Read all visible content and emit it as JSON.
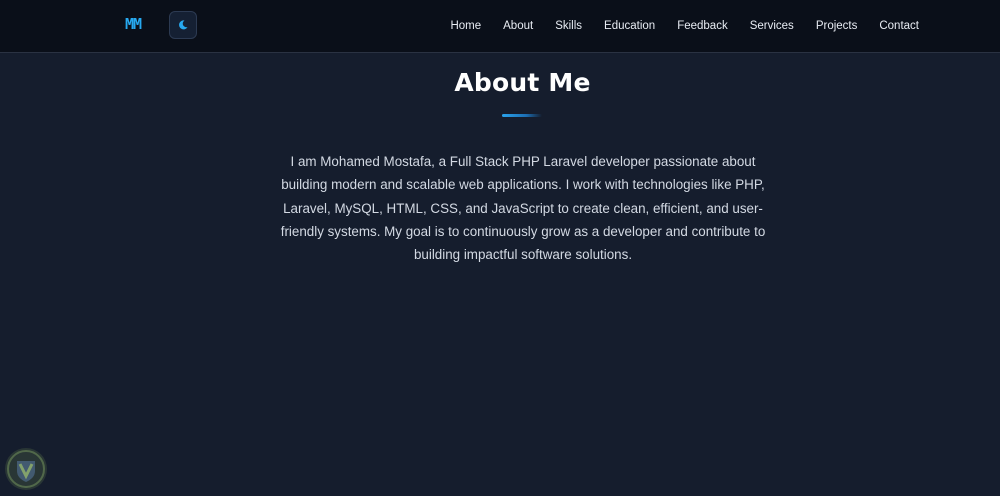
{
  "navbar": {
    "logo": "MM",
    "theme_toggle_icon": "moon-icon",
    "links": [
      "Home",
      "About",
      "Skills",
      "Education",
      "Feedback",
      "Services",
      "Projects",
      "Contact"
    ]
  },
  "about": {
    "title": "About Me",
    "text": "I am Mohamed Mostafa, a Full Stack PHP Laravel developer passionate about building modern and scalable web applications. I work with technologies like PHP, Laravel, MySQL, HTML, CSS, and JavaScript to create clean, efficient, and user-friendly systems. My goal is to continuously grow as a developer and contribute to building impactful software solutions."
  },
  "colors": {
    "accent": "#27a9f0",
    "background": "#151d2d",
    "navbar": "#0a0f19"
  },
  "badge": {
    "icon": "shield-badge-icon"
  }
}
